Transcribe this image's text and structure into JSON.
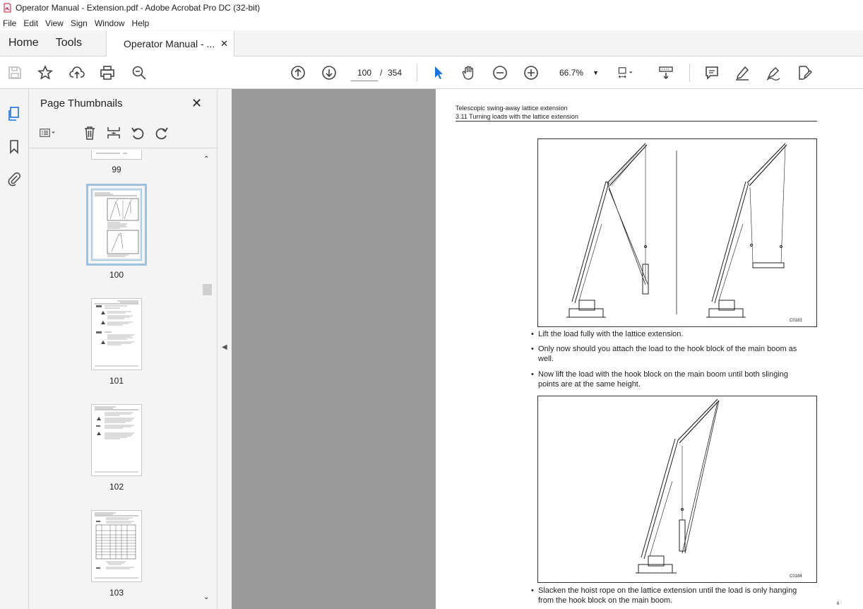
{
  "window": {
    "title": "Operator Manual - Extension.pdf - Adobe Acrobat Pro DC (32-bit)"
  },
  "menu": [
    "File",
    "Edit",
    "View",
    "Sign",
    "Window",
    "Help"
  ],
  "tabs": {
    "home": "Home",
    "tools": "Tools",
    "doc": "Operator Manual - ...",
    "close": "✕"
  },
  "toolbar": {
    "page_current": "100",
    "page_sep": "/",
    "page_total": "354",
    "zoom": "66.7%"
  },
  "thumbnails": {
    "title": "Page Thumbnails",
    "close": "✕",
    "pages": [
      {
        "label": "99"
      },
      {
        "label": "100",
        "selected": true
      },
      {
        "label": "101"
      },
      {
        "label": "102"
      },
      {
        "label": "103"
      }
    ]
  },
  "document": {
    "header_line1": "Telescopic swing-away lattice extension",
    "header_line2": "3.11 Turning loads with the lattice extension",
    "figure1_code": "C0183",
    "figure2_code": "C0184",
    "bullets1": [
      "Lift the load fully with the lattice extension.",
      "Only now should you attach the load to the hook block of the main boom as well.",
      "Now lift the load with the hook block on the main boom until both slinging points are at the same height."
    ],
    "bullets2": [
      "Slacken the hoist rope on the lattice extension until the load is only hanging from the hook block on the main boom."
    ],
    "corner": "6"
  }
}
